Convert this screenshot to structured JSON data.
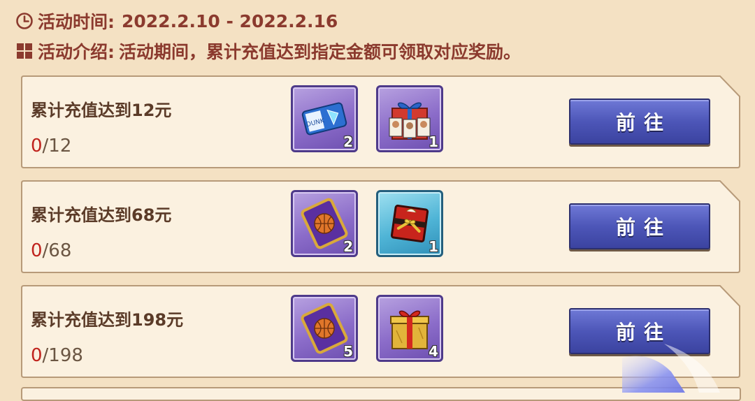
{
  "header": {
    "time_label": "活动时间:",
    "time_value": "2022.2.10 - 2022.2.16",
    "intro_label": "活动介绍:",
    "intro_value": "活动期间，累计充值达到指定金额可领取对应奖励。"
  },
  "rows": [
    {
      "title": "累计充值达到12元",
      "progress_current": "0",
      "progress_target": "/12",
      "items": [
        {
          "icon": "dunk-ticket-icon",
          "count": "2"
        },
        {
          "icon": "player-card-gift-icon",
          "count": "1"
        }
      ],
      "button_label": "前往"
    },
    {
      "title": "累计充值达到68元",
      "progress_current": "0",
      "progress_target": "/68",
      "items": [
        {
          "icon": "basketball-card-icon",
          "count": "2"
        },
        {
          "icon": "red-gift-box-icon",
          "count": "1"
        }
      ],
      "button_label": "前往"
    },
    {
      "title": "累计充值达到198元",
      "progress_current": "0",
      "progress_target": "/198",
      "items": [
        {
          "icon": "basketball-card-icon",
          "count": "5"
        },
        {
          "icon": "gold-gift-box-icon",
          "count": "4"
        }
      ],
      "button_label": "前往"
    }
  ],
  "colors": {
    "background": "#f4e1c3",
    "card": "#fbf1e0",
    "header_text": "#8b3a2e",
    "progress_current": "#c0231d",
    "button": "#4d56b8"
  }
}
